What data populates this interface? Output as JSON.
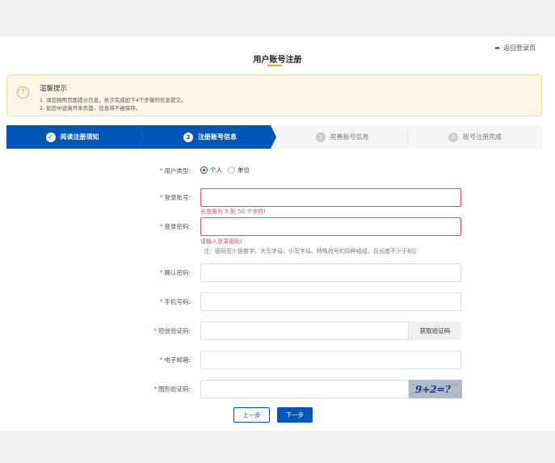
{
  "header": {
    "back_link": "返回登录页",
    "title": "用户账号注册"
  },
  "notice": {
    "title": "温馨提示",
    "lines": [
      "1. 请您按照页面提示信息，依次完成如下4个步骤的信息提交。",
      "2. 如您中途离开本页面，信息将不被保存。"
    ]
  },
  "steps": [
    {
      "num": "✓",
      "label": "阅读注册须知",
      "state": "done"
    },
    {
      "num": "2",
      "label": "注册账号信息",
      "state": "active"
    },
    {
      "num": "3",
      "label": "完善账号信息",
      "state": "inactive"
    },
    {
      "num": "4",
      "label": "账号注册完成",
      "state": "inactive"
    }
  ],
  "form": {
    "user_type": {
      "label": "用户类型:",
      "options": [
        "个人",
        "单位"
      ],
      "selected": "个人"
    },
    "account": {
      "label": "登录账号:",
      "value": "",
      "error": "长度需为 5 到 50 个字符!"
    },
    "password": {
      "label": "登录密码:",
      "value": "",
      "error": "请输入登录密码!",
      "hint": "注：密码至少是数字、大写字母、小写字母、特殊符号的四种组成，且长度不少于8位"
    },
    "confirm_password": {
      "label": "确认密码:",
      "value": ""
    },
    "phone": {
      "label": "手机号码:",
      "value": ""
    },
    "sms_code": {
      "label": "短信验证码:",
      "value": "",
      "button": "获取验证码"
    },
    "email": {
      "label": "电子邮箱:",
      "value": ""
    },
    "captcha": {
      "label": "图形验证码:",
      "value": "",
      "image_text": "9+2=?"
    }
  },
  "buttons": {
    "prev": "上一步",
    "next": "下一步"
  },
  "colors": {
    "primary": "#0055b8",
    "error": "#e05050",
    "warning": "#e6a23c"
  }
}
